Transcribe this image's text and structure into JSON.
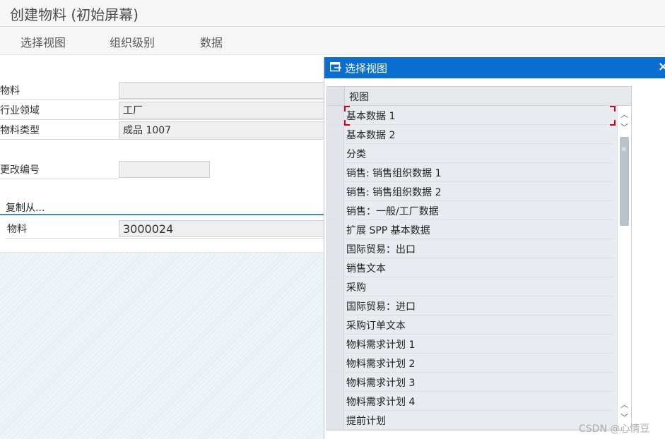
{
  "window": {
    "title": "创建物料 (初始屏幕)"
  },
  "menu": {
    "items": [
      "选择视图",
      "组织级别",
      "数据"
    ]
  },
  "form": {
    "material_label": "物料",
    "material_value": "",
    "industry_label": "行业领域",
    "industry_value": "工厂",
    "type_label": "物料类型",
    "type_value": "成品 1007",
    "change_label": "更改编号",
    "change_value": "",
    "copy_from_title": "复制从...",
    "copy_material_label": "物料",
    "copy_material_value": "3000024"
  },
  "dialog": {
    "title": "选择视图",
    "icon": "select-view-icon",
    "close_label": "×",
    "column_header": "视图",
    "views": [
      "基本数据 1",
      "基本数据 2",
      "分类",
      "销售: 销售组织数据 1",
      "销售: 销售组织数据 2",
      "销售：一般/工厂数据",
      "扩展 SPP 基本数据",
      "国际贸易：出口",
      "销售文本",
      "采购",
      "国际贸易：进口",
      "采购订单文本",
      "物料需求计划 1",
      "物料需求计划 2",
      "物料需求计划 3",
      "物料需求计划 4",
      "提前计划"
    ]
  },
  "watermark": "CSDN @心情豆",
  "colors": {
    "dialog_header": "#0a6ed1",
    "accent_line": "#3a8bc9",
    "focus_marker": "#d0021b"
  }
}
